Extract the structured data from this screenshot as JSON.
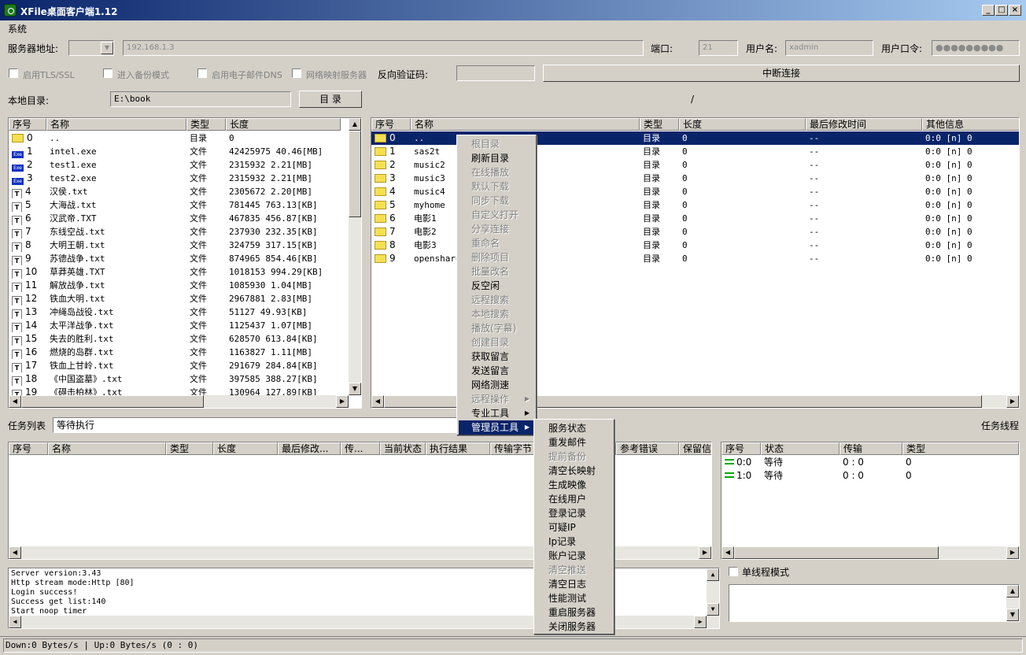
{
  "window": {
    "title": "XFile桌面客户端1.12",
    "min": "_",
    "max": "□",
    "close": "×"
  },
  "menubar": {
    "system": "系统"
  },
  "connection": {
    "server_label": "服务器地址:",
    "server_value": "192.168.1.3",
    "port_label": "端口:",
    "port_value": "21",
    "user_label": "用户名:",
    "user_value": "xadmin",
    "password_label": "用户口令:",
    "password_value": "●●●●●●●●●"
  },
  "options": {
    "tls": "启用TLS/SSL",
    "backup": "进入备份模式",
    "email": "启用电子邮件DNS",
    "mapping": "网络映射服务器",
    "verify_label": "反向验证码:",
    "disconnect": "中断连接"
  },
  "local": {
    "label": "本地目录:",
    "path": "E:\\book",
    "dir_button": "目 录",
    "remote_path": "/"
  },
  "local_table": {
    "headers": [
      "序号",
      "名称",
      "类型",
      "长度"
    ],
    "rows": [
      {
        "icon": "folder",
        "idx": "0",
        "name": "..",
        "type": "目录",
        "len": "0"
      },
      {
        "icon": "exe",
        "idx": "1",
        "name": "intel.exe",
        "type": "文件",
        "len": "42425975  40.46[MB]"
      },
      {
        "icon": "exe",
        "idx": "2",
        "name": "test1.exe",
        "type": "文件",
        "len": "2315932   2.21[MB]"
      },
      {
        "icon": "exe",
        "idx": "3",
        "name": "test2.exe",
        "type": "文件",
        "len": "2315932   2.21[MB]"
      },
      {
        "icon": "txt",
        "idx": "4",
        "name": "汉侯.txt",
        "type": "文件",
        "len": "2305672   2.20[MB]"
      },
      {
        "icon": "txt",
        "idx": "5",
        "name": "大海战.txt",
        "type": "文件",
        "len": "781445  763.13[KB]"
      },
      {
        "icon": "txt",
        "idx": "6",
        "name": "汉武帝.TXT",
        "type": "文件",
        "len": "467835  456.87[KB]"
      },
      {
        "icon": "txt",
        "idx": "7",
        "name": "东线空战.txt",
        "type": "文件",
        "len": "237930  232.35[KB]"
      },
      {
        "icon": "txt",
        "idx": "8",
        "name": "大明王朝.txt",
        "type": "文件",
        "len": "324759  317.15[KB]"
      },
      {
        "icon": "txt",
        "idx": "9",
        "name": "苏德战争.txt",
        "type": "文件",
        "len": "874965  854.46[KB]"
      },
      {
        "icon": "txt",
        "idx": "10",
        "name": "草莽英雄.TXT",
        "type": "文件",
        "len": "1018153  994.29[KB]"
      },
      {
        "icon": "txt",
        "idx": "11",
        "name": "解放战争.txt",
        "type": "文件",
        "len": "1085930   1.04[MB]"
      },
      {
        "icon": "txt",
        "idx": "12",
        "name": "铁血大明.txt",
        "type": "文件",
        "len": "2967881   2.83[MB]"
      },
      {
        "icon": "txt",
        "idx": "13",
        "name": "冲绳岛战役.txt",
        "type": "文件",
        "len": "51127  49.93[KB]"
      },
      {
        "icon": "txt",
        "idx": "14",
        "name": "太平洋战争.txt",
        "type": "文件",
        "len": "1125437   1.07[MB]"
      },
      {
        "icon": "txt",
        "idx": "15",
        "name": "失去的胜利.txt",
        "type": "文件",
        "len": "628570  613.84[KB]"
      },
      {
        "icon": "txt",
        "idx": "16",
        "name": "燃烧的岛群.txt",
        "type": "文件",
        "len": "1163827   1.11[MB]"
      },
      {
        "icon": "txt",
        "idx": "17",
        "name": "铁血上甘岭.txt",
        "type": "文件",
        "len": "291679  284.84[KB]"
      },
      {
        "icon": "txt",
        "idx": "18",
        "name": "《中国盗墓》.txt",
        "type": "文件",
        "len": "397585  388.27[KB]"
      },
      {
        "icon": "txt",
        "idx": "19",
        "name": "《碍击柏林》.txt",
        "type": "文件",
        "len": "130964  127.89[KB]"
      }
    ]
  },
  "remote_table": {
    "headers": [
      "序号",
      "名称",
      "类型",
      "长度",
      "最后修改时间",
      "其他信息"
    ],
    "rows": [
      {
        "idx": "0",
        "name": "..",
        "type": "目录",
        "len": "0",
        "mtime": "--",
        "info": "0:0 [n] 0"
      },
      {
        "idx": "1",
        "name": "sas2t",
        "type": "目录",
        "len": "0",
        "mtime": "--",
        "info": "0:0 [n] 0"
      },
      {
        "idx": "2",
        "name": "music2",
        "type": "目录",
        "len": "0",
        "mtime": "--",
        "info": "0:0 [n] 0"
      },
      {
        "idx": "3",
        "name": "music3",
        "type": "目录",
        "len": "0",
        "mtime": "--",
        "info": "0:0 [n] 0"
      },
      {
        "idx": "4",
        "name": "music4",
        "type": "目录",
        "len": "0",
        "mtime": "--",
        "info": "0:0 [n] 0"
      },
      {
        "idx": "5",
        "name": "myhome",
        "type": "目录",
        "len": "0",
        "mtime": "--",
        "info": "0:0 [n] 0"
      },
      {
        "idx": "6",
        "name": "电影1",
        "type": "目录",
        "len": "0",
        "mtime": "--",
        "info": "0:0 [n] 0"
      },
      {
        "idx": "7",
        "name": "电影2",
        "type": "目录",
        "len": "0",
        "mtime": "--",
        "info": "0:0 [n] 0"
      },
      {
        "idx": "8",
        "name": "电影3",
        "type": "目录",
        "len": "0",
        "mtime": "--",
        "info": "0:0 [n] 0"
      },
      {
        "idx": "9",
        "name": "openshare",
        "type": "目录",
        "len": "0",
        "mtime": "--",
        "info": "0:0 [n] 0"
      }
    ]
  },
  "context_menu": [
    {
      "label": "根目录",
      "disabled": true
    },
    {
      "label": "刷新目录",
      "disabled": false
    },
    {
      "label": "在线播放",
      "disabled": true
    },
    {
      "label": "默认下载",
      "disabled": true
    },
    {
      "label": "同步下载",
      "disabled": true
    },
    {
      "label": "自定义打开",
      "disabled": true
    },
    {
      "label": "分享连接",
      "disabled": true
    },
    {
      "label": "重命名",
      "disabled": true
    },
    {
      "label": "删除项目",
      "disabled": true
    },
    {
      "label": "批量改名",
      "disabled": true
    },
    {
      "label": "反空闲",
      "disabled": false
    },
    {
      "label": "远程搜索",
      "disabled": true
    },
    {
      "label": "本地搜索",
      "disabled": true
    },
    {
      "label": "播放(字幕)",
      "disabled": true
    },
    {
      "label": "创建目录",
      "disabled": true
    },
    {
      "label": "获取留言",
      "disabled": false
    },
    {
      "label": "发送留言",
      "disabled": false
    },
    {
      "label": "网络测速",
      "disabled": false
    },
    {
      "label": "远程操作",
      "disabled": true,
      "sub": true
    },
    {
      "label": "专业工具",
      "disabled": false,
      "sub": true
    },
    {
      "label": "管理员工具",
      "disabled": false,
      "sub": true,
      "selected": true
    }
  ],
  "submenu": [
    {
      "label": "服务状态",
      "disabled": false
    },
    {
      "label": "重发邮件",
      "disabled": false
    },
    {
      "label": "提前备份",
      "disabled": true
    },
    {
      "label": "清空长映射",
      "disabled": false
    },
    {
      "label": "生成映像",
      "disabled": false
    },
    {
      "label": "在线用户",
      "disabled": false
    },
    {
      "label": "登录记录",
      "disabled": false
    },
    {
      "label": "可疑IP",
      "disabled": false
    },
    {
      "label": "Ip记录",
      "disabled": false
    },
    {
      "label": "账户记录",
      "disabled": false
    },
    {
      "label": "清空推送",
      "disabled": true
    },
    {
      "label": "清空日志",
      "disabled": false
    },
    {
      "label": "性能测试",
      "disabled": false
    },
    {
      "label": "重启服务器",
      "disabled": false
    },
    {
      "label": "关闭服务器",
      "disabled": false
    }
  ],
  "tasks": {
    "label": "任务列表",
    "status": "等待执行",
    "threads_label": "任务线程",
    "headers": [
      "序号",
      "名称",
      "类型",
      "长度",
      "最后修改...",
      "传...",
      "当前状态",
      "执行结果",
      "传输字节",
      "",
      "参考错误",
      "保留信"
    ]
  },
  "threads": {
    "headers": [
      "序号",
      "状态",
      "传输",
      "类型"
    ],
    "rows": [
      {
        "idx": "0:0",
        "state": "等待",
        "trans": "0 : 0",
        "type": "0"
      },
      {
        "idx": "1:0",
        "state": "等待",
        "trans": "0 : 0",
        "type": "0"
      }
    ],
    "single_mode": "单线程模式"
  },
  "log": [
    "Server version:3.43",
    "Http stream mode:Http [80]",
    "Login success!",
    "Success get list:140",
    "Start noop timer"
  ],
  "status": "Down:0 Bytes/s | Up:0 Bytes/s (0 : 0)"
}
